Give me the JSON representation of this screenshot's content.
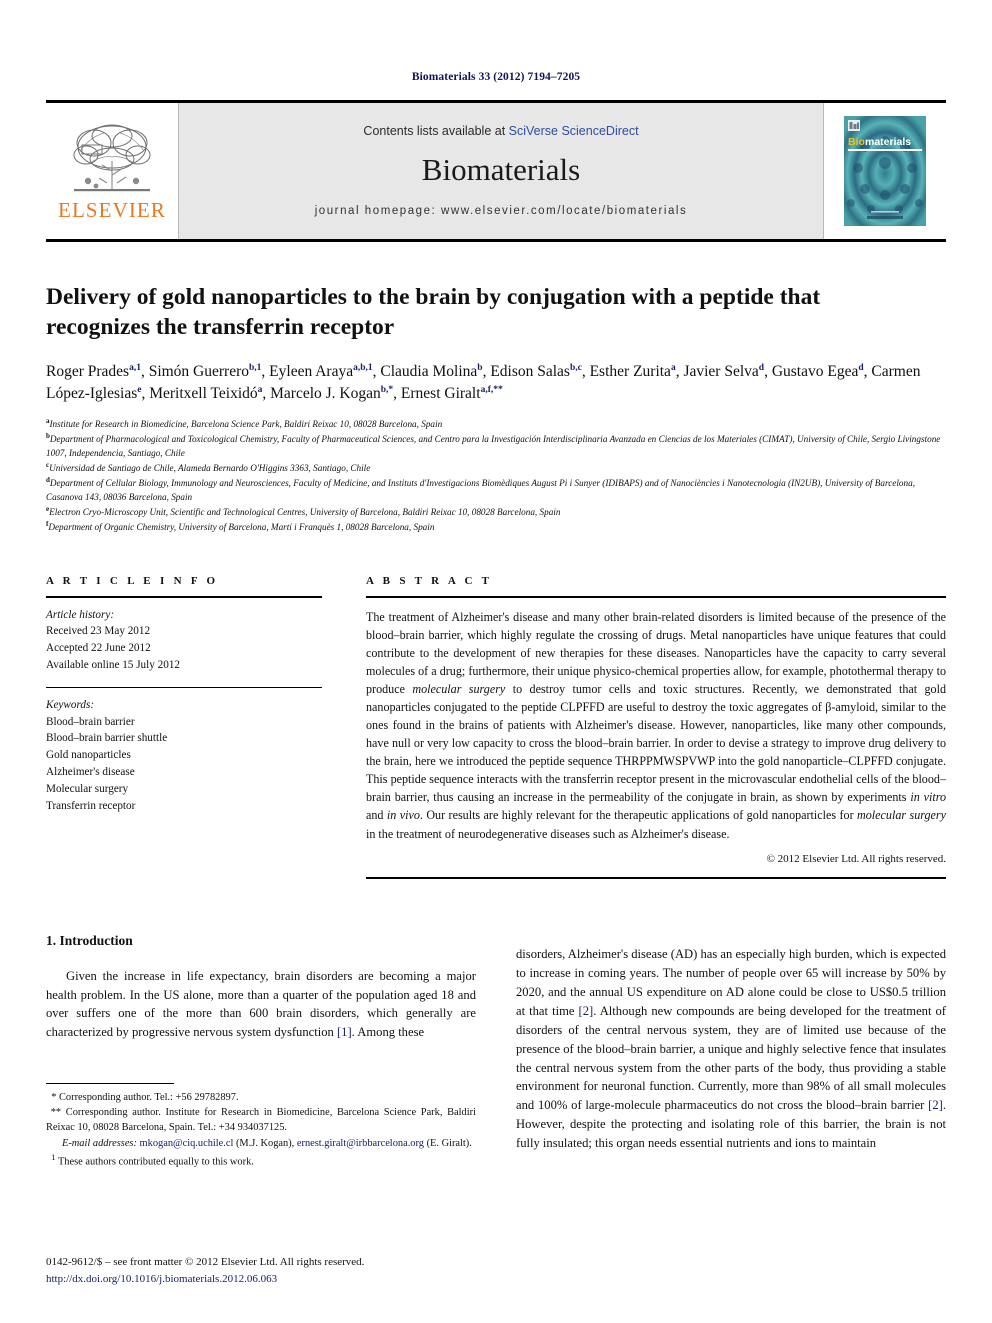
{
  "running_head": "Biomaterials 33 (2012) 7194–7205",
  "masthead": {
    "publisher_name": "ELSEVIER",
    "publisher_logo_alt": "elsevier-tree-logo",
    "contents_prefix": "Contents lists available at ",
    "contents_link": "SciVerse ScienceDirect",
    "journal_name": "Biomaterials",
    "homepage": "journal homepage: www.elsevier.com/locate/biomaterials",
    "cover_title": "Biomaterials"
  },
  "article": {
    "title": "Delivery of gold nanoparticles to the brain by conjugation with a peptide that recognizes the transferrin receptor",
    "authors": [
      {
        "name": "Roger Prades",
        "sup": "a,1",
        "sep": ", "
      },
      {
        "name": "Simón Guerrero",
        "sup": "b,1",
        "sep": ", "
      },
      {
        "name": "Eyleen Araya",
        "sup": "a,b,1",
        "sep": ", "
      },
      {
        "name": "Claudia Molina",
        "sup": "b",
        "sep": ", "
      },
      {
        "name": "Edison Salas",
        "sup": "b,c",
        "sep": ", "
      },
      {
        "name": "Esther Zurita",
        "sup": "a",
        "sep": ", "
      },
      {
        "name": "Javier Selva",
        "sup": "d",
        "sep": ", "
      },
      {
        "name": "Gustavo Egea",
        "sup": "d",
        "sep": ", "
      },
      {
        "name": "Carmen López-Iglesias",
        "sup": "e",
        "sep": ", "
      },
      {
        "name": "Meritxell Teixidó",
        "sup": "a",
        "sep": ", "
      },
      {
        "name": "Marcelo J. Kogan",
        "sup": "b,*",
        "sep": ", "
      },
      {
        "name": "Ernest Giralt",
        "sup": "a,f,**",
        "sep": ""
      }
    ],
    "affiliations": [
      {
        "mark": "a",
        "text": "Institute for Research in Biomedicine, Barcelona Science Park, Baldiri Reixac 10, 08028 Barcelona, Spain"
      },
      {
        "mark": "b",
        "text": "Department of Pharmacological and Toxicological Chemistry, Faculty of Pharmaceutical Sciences, and Centro para la Investigación Interdisciplinaria Avanzada en Ciencias de los Materiales (CIMAT), University of Chile, Sergio Livingstone 1007, Independencia, Santiago, Chile"
      },
      {
        "mark": "c",
        "text": "Universidad de Santiago de Chile, Alameda Bernardo O'Higgins 3363, Santiago, Chile"
      },
      {
        "mark": "d",
        "text": "Department of Cellular Biology, Immunology and Neurosciences, Faculty of Medicine, and Instituts d'Investigacions Biomèdiques August Pi i Sunyer (IDIBAPS) and of Nanociències i Nanotecnologia (IN2UB), University of Barcelona, Casanova 143, 08036 Barcelona, Spain"
      },
      {
        "mark": "e",
        "text": "Electron Cryo-Microscopy Unit, Scientific and Technological Centres, University of Barcelona, Baldiri Reixac 10, 08028 Barcelona, Spain"
      },
      {
        "mark": "f",
        "text": "Department of Organic Chemistry, University of Barcelona, Martí i Franquès 1, 08028 Barcelona, Spain"
      }
    ]
  },
  "article_info": {
    "heading": "A R T I C L E   I N F O",
    "history_label": "Article history:",
    "history": [
      "Received 23 May 2012",
      "Accepted 22 June 2012",
      "Available online 15 July 2012"
    ],
    "keywords_label": "Keywords:",
    "keywords": [
      "Blood–brain barrier",
      "Blood–brain barrier shuttle",
      "Gold nanoparticles",
      "Alzheimer's disease",
      "Molecular surgery",
      "Transferrin receptor"
    ]
  },
  "abstract": {
    "heading": "A B S T R A C T",
    "p1": "The treatment of Alzheimer's disease and many other brain-related disorders is limited because of the presence of the blood–brain barrier, which highly regulate the crossing of drugs. Metal nanoparticles have unique features that could contribute to the development of new therapies for these diseases. Nanoparticles have the capacity to carry several molecules of a drug; furthermore, their unique physico-chemical properties allow, for example, photothermal therapy to produce ",
    "em1": "molecular surgery",
    "p2": " to destroy tumor cells and toxic structures. Recently, we demonstrated that gold nanoparticles conjugated to the peptide CLPFFD are useful to destroy the toxic aggregates of β-amyloid, similar to the ones found in the brains of patients with Alzheimer's disease. However, nanoparticles, like many other compounds, have null or very low capacity to cross the blood–brain barrier. In order to devise a strategy to improve drug delivery to the brain, here we introduced the peptide sequence THRPPMWSPVWP into the gold nanoparticle–CLPFFD conjugate. This peptide sequence interacts with the transferrin receptor present in the microvascular endothelial cells of the blood–brain barrier, thus causing an increase in the permeability of the conjugate in brain, as shown by experiments ",
    "em2": "in vitro",
    "p3": " and ",
    "em3": "in vivo",
    "p4": ". Our results are highly relevant for the therapeutic applications of gold nanoparticles for ",
    "em4": "molecular surgery",
    "p5": " in the treatment of neurodegenerative diseases such as Alzheimer's disease.",
    "copyright": "© 2012 Elsevier Ltd. All rights reserved."
  },
  "introduction": {
    "heading": "1. Introduction",
    "left_p1_a": "Given the increase in life expectancy, brain disorders are becoming a major health problem. In the US alone, more than a quarter of the population aged 18 and over suffers one of the more than 600 brain disorders, which generally are characterized by progressive nervous system dysfunction ",
    "left_ref1": "[1]",
    "left_p1_b": ". Among these",
    "right_p1_a": "disorders, Alzheimer's disease (AD) has an especially high burden, which is expected to increase in coming years. The number of people over 65 will increase by 50% by 2020, and the annual US expenditure on AD alone could be close to US$0.5 trillion at that time ",
    "right_ref1": "[2]",
    "right_p1_b": ". Although new compounds are being developed for the treatment of disorders of the central nervous system, they are of limited use because of the presence of the blood–brain barrier, a unique and highly selective fence that insulates the central nervous system from the other parts of the body, thus providing a stable environment for neuronal function. Currently, more than 98% of all small molecules and 100% of large-molecule pharmaceutics do not cross the blood–brain barrier ",
    "right_ref2": "[2]",
    "right_p1_c": ". However, despite the protecting and isolating role of this barrier, the brain is not fully insulated; this organ needs essential nutrients and ions to maintain"
  },
  "footnotes": {
    "star1_mark": "*",
    "star1_text": " Corresponding author. Tel.: +56 29782897.",
    "star2_mark": "**",
    "star2_text": " Corresponding author. Institute for Research in Biomedicine, Barcelona Science Park, Baldiri Reixac 10, 08028 Barcelona, Spain. Tel.: +34 934037125.",
    "email_label": "E-mail addresses:",
    "email1": "mkogan@ciq.uchile.cl",
    "email1_owner": " (M.J. Kogan), ",
    "email2": "ernest.giralt@irbbarcelona.org",
    "email2_owner": " (E. Giralt).",
    "dagger_mark": "1",
    "dagger_text": " These authors contributed equally to this work."
  },
  "colophon": {
    "line1": "0142-9612/$ – see front matter © 2012 Elsevier Ltd. All rights reserved.",
    "doi": "http://dx.doi.org/10.1016/j.biomaterials.2012.06.063"
  }
}
